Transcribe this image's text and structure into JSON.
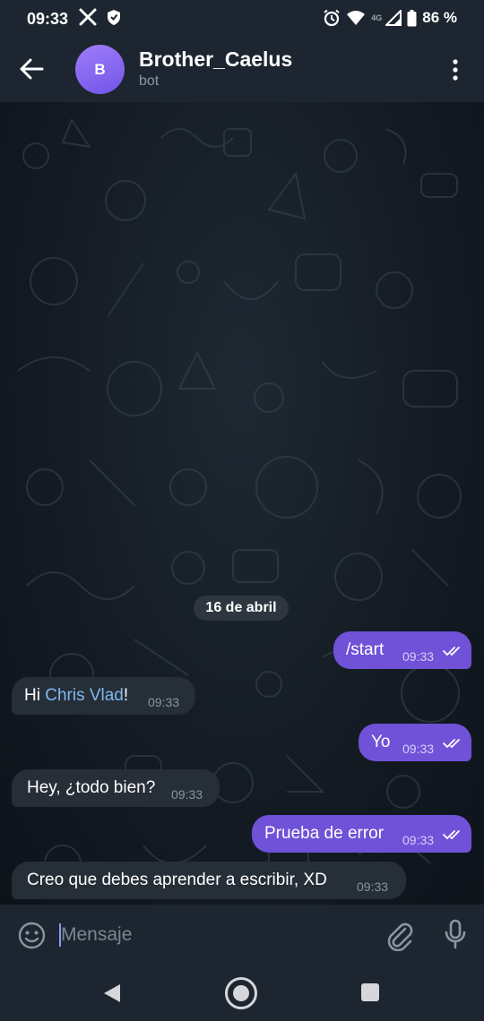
{
  "status_bar": {
    "time": "09:33",
    "network": "4G",
    "battery": "86 %"
  },
  "header": {
    "avatar_letter": "B",
    "title": "Brother_Caelus",
    "subtitle": "bot"
  },
  "chat": {
    "date_label": "16 de abril",
    "messages": [
      {
        "dir": "out",
        "text": "/start",
        "time": "09:33"
      },
      {
        "dir": "in",
        "text_before": "Hi ",
        "mention": "Chris Vlad",
        "text_after": "!",
        "time": "09:33"
      },
      {
        "dir": "out",
        "text": "Yo",
        "time": "09:33"
      },
      {
        "dir": "in",
        "text": "Hey, ¿todo bien?",
        "time": "09:33"
      },
      {
        "dir": "out",
        "text": "Prueba de error",
        "time": "09:33"
      },
      {
        "dir": "in",
        "text": "Creo que debes aprender a escribir, XD",
        "time": "09:33"
      }
    ]
  },
  "composer": {
    "placeholder": "Mensaje"
  },
  "colors": {
    "outgoing_bubble": "#6f52d8",
    "incoming_bubble": "#262e37",
    "mention": "#7fb8ef",
    "header": "#1d2630"
  },
  "icons": [
    "x-icon",
    "shield-icon",
    "alarm-icon",
    "wifi-icon",
    "signal-icon",
    "battery-icon",
    "back-arrow-icon",
    "more-vert-icon",
    "read-ticks-icon",
    "emoji-icon",
    "attach-icon",
    "mic-icon",
    "nav-back-icon",
    "nav-home-icon",
    "nav-recents-icon"
  ]
}
